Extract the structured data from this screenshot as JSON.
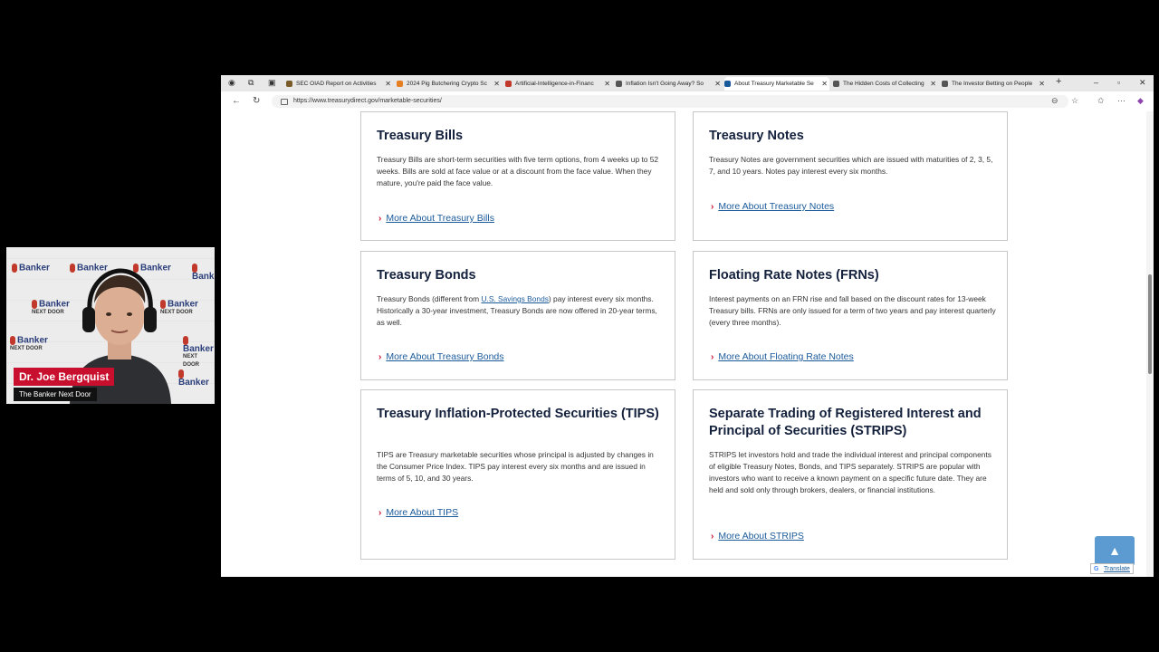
{
  "webcam": {
    "name": "Dr. Joe Bergquist",
    "show": "The Banker Next Door",
    "logo_line1": "Banker",
    "logo_line2": "NEXT DOOR",
    "logo_the": "The"
  },
  "browser": {
    "tabs": [
      {
        "label": "SEC OIAD Report on Activities",
        "favicon_color": "#7a5b2a"
      },
      {
        "label": "2024 Pig Butchering Crypto Sc",
        "favicon_color": "#e67e22"
      },
      {
        "label": "Artificial-Intelligence-in-Financ",
        "favicon_color": "#c0392b"
      },
      {
        "label": "Inflation Isn't Going Away? So",
        "favicon_color": "#555555"
      },
      {
        "label": "About Treasury Marketable Se",
        "favicon_color": "#1a5a9b",
        "active": true
      },
      {
        "label": "The Hidden Costs of Collecting",
        "favicon_color": "#555555"
      },
      {
        "label": "The Investor Betting on People",
        "favicon_color": "#555555"
      }
    ],
    "url": "https://www.treasurydirect.gov/marketable-securities/"
  },
  "cards": [
    {
      "title": "Treasury Bills",
      "text": "Treasury Bills are short-term securities with five term options, from 4 weeks up to 52 weeks. Bills are sold at face value or at a discount from the face value. When they mature, you're paid the face value.",
      "link": "More About Treasury Bills"
    },
    {
      "title": "Treasury Notes",
      "text": "Treasury Notes are government securities which are issued with maturities of 2, 3, 5, 7, and 10 years. Notes pay interest every six months.",
      "link": "More About Treasury Notes"
    },
    {
      "title": "Treasury Bonds",
      "text_before": "Treasury Bonds (different from ",
      "text_link": "U.S. Savings Bonds",
      "text_after": ") pay interest every six months. Historically a 30-year investment, Treasury Bonds are now offered in 20-year terms, as well.",
      "link": "More About Treasury Bonds"
    },
    {
      "title": "Floating Rate Notes (FRNs)",
      "text": "Interest payments on an FRN rise and fall based on the discount rates for 13-week Treasury bills. FRNs are only issued for a term of two years and pay interest quarterly (every three months).",
      "link": "More About Floating Rate Notes"
    },
    {
      "title": "Treasury Inflation-Protected Securities (TIPS)",
      "text": "TIPS are Treasury marketable securities whose principal is adjusted by changes in the Consumer Price Index. TIPS pay interest every six months and are issued in terms of 5, 10, and 30 years.",
      "link": "More About TIPS"
    },
    {
      "title": "Separate Trading of Registered Interest and Principal of Securities (STRIPS)",
      "text": "STRIPS let investors hold and trade the individual interest and principal components of eligible Treasury Notes, Bonds, and TIPS separately. STRIPS are popular with investors who want to receive a known payment on a specific future date. They are held and sold only through brokers, dealers, or financial institutions.",
      "link": "More About STRIPS"
    }
  ],
  "widgets": {
    "translate": "Translate",
    "to_top_icon": "chevron-up-icon"
  }
}
